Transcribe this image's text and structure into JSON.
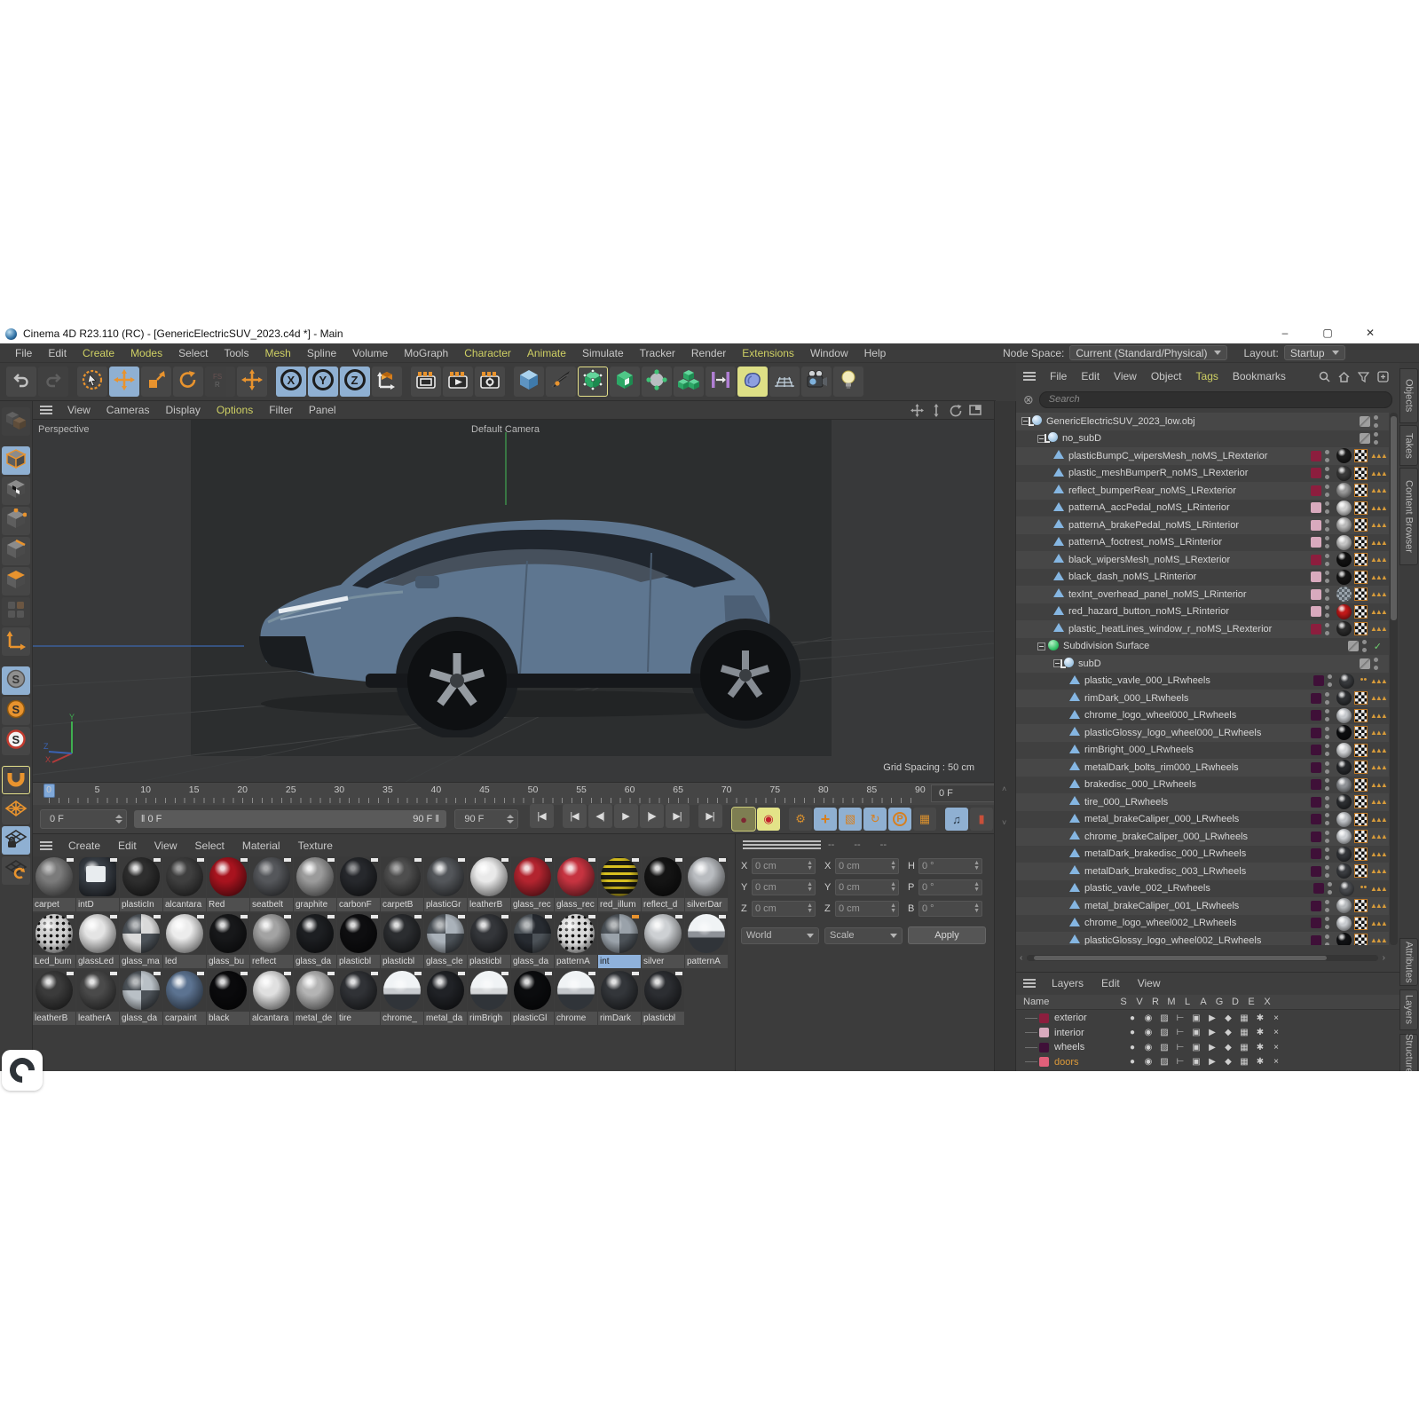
{
  "window": {
    "title": "Cinema 4D R23.110 (RC) - [GenericElectricSUV_2023.c4d *] - Main",
    "buttons": {
      "minimize": "–",
      "maximize": "▢",
      "close": "✕"
    }
  },
  "menu_bar": {
    "items": [
      {
        "label": "File"
      },
      {
        "label": "Edit"
      },
      {
        "label": "Create",
        "accent": true
      },
      {
        "label": "Modes",
        "accent": true
      },
      {
        "label": "Select"
      },
      {
        "label": "Tools"
      },
      {
        "label": "Mesh",
        "accent": true
      },
      {
        "label": "Spline"
      },
      {
        "label": "Volume"
      },
      {
        "label": "MoGraph"
      },
      {
        "label": "Character",
        "accent": true
      },
      {
        "label": "Animate",
        "accent": true
      },
      {
        "label": "Simulate"
      },
      {
        "label": "Tracker"
      },
      {
        "label": "Render"
      },
      {
        "label": "Extensions",
        "accent": true
      },
      {
        "label": "Window"
      },
      {
        "label": "Help"
      }
    ]
  },
  "node_space": {
    "label": "Node Space:",
    "value": "Current (Standard/Physical)"
  },
  "layout": {
    "label": "Layout:",
    "value": "Startup"
  },
  "toolbar": [
    {
      "name": "undo-button",
      "icon": "undo"
    },
    {
      "name": "redo-button",
      "icon": "redo",
      "disabled": true
    },
    {
      "sep": true
    },
    {
      "name": "live-selection-button",
      "icon": "cursor"
    },
    {
      "name": "move-button",
      "icon": "move",
      "bg": "blue"
    },
    {
      "name": "scale-button",
      "icon": "scale"
    },
    {
      "name": "rotate-button",
      "icon": "rotate"
    },
    {
      "name": "last-tool-button",
      "icon": "fsr",
      "disabled": true
    },
    {
      "name": "move-tool-button",
      "icon": "move"
    },
    {
      "sep": true
    },
    {
      "name": "x-axis-lock-button",
      "icon": "X",
      "bg": "blue"
    },
    {
      "name": "y-axis-lock-button",
      "icon": "Y",
      "bg": "blue"
    },
    {
      "name": "z-axis-lock-button",
      "icon": "Z",
      "bg": "blue"
    },
    {
      "name": "coordinate-system-button",
      "icon": "coordsys"
    },
    {
      "sep": true
    },
    {
      "name": "render-view-button",
      "icon": "clapper"
    },
    {
      "name": "render-picture-viewer-button",
      "icon": "clapperplay"
    },
    {
      "name": "render-settings-button",
      "icon": "clappergear"
    },
    {
      "sep": true
    },
    {
      "name": "add-cube-object-button",
      "icon": "cube"
    },
    {
      "name": "spline-pen-button",
      "icon": "pen"
    },
    {
      "name": "subdivision-surface-button",
      "icon": "sds",
      "outlined": true
    },
    {
      "name": "generators-button",
      "icon": "opencube"
    },
    {
      "name": "deformers-button",
      "icon": "deformer"
    },
    {
      "name": "mograph-cloner-button",
      "icon": "cubes3"
    },
    {
      "name": "fields-button",
      "icon": "field"
    },
    {
      "name": "volume-button",
      "icon": "volume",
      "bg": "yellow"
    },
    {
      "name": "floor-button",
      "icon": "floor"
    },
    {
      "name": "camera-button",
      "icon": "camera"
    },
    {
      "name": "light-button",
      "icon": "light"
    }
  ],
  "left_toolbar": [
    {
      "name": "make-editable-button",
      "icon": "cubegray",
      "disabled": true
    },
    {
      "gap": true
    },
    {
      "name": "model-mode-button",
      "icon": "cubemode",
      "bg": "blue"
    },
    {
      "name": "texture-mode-button",
      "icon": "cubechecker"
    },
    {
      "name": "point-mode-button",
      "icon": "cubepoints"
    },
    {
      "name": "edge-mode-button",
      "icon": "cubeedge"
    },
    {
      "name": "polygon-mode-button",
      "icon": "cubeface"
    },
    {
      "name": "tweak-mode-button",
      "icon": "tiles",
      "disabled": true
    },
    {
      "name": "enable-axis-button",
      "icon": "axis"
    },
    {
      "gap": true
    },
    {
      "name": "viewport-filter-button",
      "icon": "sgray",
      "bg": "blue"
    },
    {
      "name": "viewport-solo-single-button",
      "icon": "sorange"
    },
    {
      "name": "viewport-solo-hierarchy-button",
      "icon": "sred"
    },
    {
      "gap": true
    },
    {
      "name": "snap-button",
      "icon": "magnet",
      "outlined": true
    },
    {
      "name": "workplane-button",
      "icon": "grid"
    },
    {
      "name": "lock-workplane-button",
      "icon": "gridlock",
      "bg": "blue"
    },
    {
      "name": "planar-workplane-button",
      "icon": "gridrotate"
    }
  ],
  "viewport": {
    "menu": [
      {
        "label": "View"
      },
      {
        "label": "Cameras"
      },
      {
        "label": "Display"
      },
      {
        "label": "Options",
        "accent": true
      },
      {
        "label": "Filter"
      },
      {
        "label": "Panel"
      }
    ],
    "view_label": "Perspective",
    "camera_label": "Default Camera",
    "grid_spacing": "Grid Spacing : 50 cm",
    "nav_icons": [
      "pan-icon",
      "zoom-icon",
      "rotate-icon",
      "maximize-icon"
    ]
  },
  "timeline": {
    "ticks": [
      0,
      5,
      10,
      15,
      20,
      25,
      30,
      35,
      40,
      45,
      50,
      55,
      60,
      65,
      70,
      75,
      80,
      85,
      90
    ],
    "current_frame": "0 F",
    "range_start": "0 F",
    "range_end": "90 F",
    "end_frame": "90 F",
    "after_field": "0 F",
    "transport": [
      {
        "name": "goto-start-button",
        "glyph": "|◀",
        "gapAfter": true
      },
      {
        "name": "goto-previous-key-button",
        "glyph": "|◀"
      },
      {
        "name": "goto-previous-frame-button",
        "glyph": "◀|"
      },
      {
        "name": "play-button",
        "glyph": "▶"
      },
      {
        "name": "goto-next-frame-button",
        "glyph": "|▶"
      },
      {
        "name": "goto-next-key-button",
        "glyph": "▶|"
      },
      {
        "name": "goto-end-button",
        "glyph": "▶|",
        "gapBefore": true
      }
    ],
    "record_buttons": [
      {
        "name": "record-keyframe-button",
        "glyph": "●",
        "bg": "#7e7e52",
        "fg": "#7e2733",
        "outlined": true
      },
      {
        "name": "autokeying-button",
        "glyph": "◉",
        "bg": "#e3e388",
        "fg": "#c41f2d"
      },
      {
        "gap": true
      },
      {
        "name": "keyframe-selection-button",
        "glyph": "⚙",
        "bg": "#484848",
        "fg": "#d78f2e"
      },
      {
        "name": "key-position-button",
        "glyph": "+",
        "bg": "#8fb0d2",
        "fg": "#d77f1e"
      },
      {
        "name": "key-scale-button",
        "glyph": "▧",
        "bg": "#8fb0d2",
        "fg": "#d77f1e"
      },
      {
        "name": "key-rotation-button",
        "glyph": "↻",
        "bg": "#8fb0d2",
        "fg": "#d77f1e"
      },
      {
        "name": "key-parameter-button",
        "glyph": "P",
        "bg": "#8fb0d2",
        "fg": "#d77f1e",
        "ring": true
      },
      {
        "name": "key-pla-button",
        "glyph": "▦",
        "bg": "#484848",
        "fg": "#d78f2e"
      },
      {
        "gap": true
      },
      {
        "name": "sound-button",
        "glyph": "♫",
        "bg": "#8fb0d2",
        "fg": "#23313f"
      },
      {
        "name": "solo-animation-button",
        "glyph": "▮",
        "bg": "#484848",
        "fg": "#c8503a"
      }
    ]
  },
  "materials": {
    "menu": [
      {
        "label": "Create"
      },
      {
        "label": "Edit"
      },
      {
        "label": "View"
      },
      {
        "label": "Select"
      },
      {
        "label": "Material"
      },
      {
        "label": "Texture"
      }
    ],
    "rows": [
      [
        {
          "n": "carpet",
          "c": "#7b7b7b",
          "t": "noise"
        },
        {
          "n": "intD",
          "c": "#3a4048",
          "t": "screen"
        },
        {
          "n": "plasticIn",
          "c": "#2e2e2e"
        },
        {
          "n": "alcantara",
          "c": "#3f3f3f",
          "t": "noise"
        },
        {
          "n": "Red",
          "c": "#a8131e"
        },
        {
          "n": "seatbelt",
          "c": "#55575b",
          "t": "noise"
        },
        {
          "n": "graphite",
          "c": "#9b9b9b"
        },
        {
          "n": "carbonF",
          "c": "#26282c",
          "t": "noise"
        },
        {
          "n": "carpetB",
          "c": "#4e4e4e",
          "t": "noise"
        },
        {
          "n": "plasticGr",
          "c": "#53565a"
        },
        {
          "n": "leatherB",
          "c": "#e9e9e9"
        },
        {
          "n": "glass_rec",
          "c": "#b3242f"
        },
        {
          "n": "glass_rec",
          "c": "#c63340"
        },
        {
          "n": "red_illum",
          "c": "#1c1c12",
          "t": "stripes"
        },
        {
          "n": "reflect_d",
          "c": "#141414"
        },
        {
          "n": "silverDar",
          "c": "#b9bcc0"
        }
      ],
      [
        {
          "n": "Led_bum",
          "c": "#cfcfcf",
          "t": "dots"
        },
        {
          "n": "glassLed",
          "c": "#e4e4e4"
        },
        {
          "n": "glass_ma",
          "c": "#dadada",
          "t": "checker"
        },
        {
          "n": "led",
          "c": "#ececec"
        },
        {
          "n": "glass_bu",
          "c": "#17181a"
        },
        {
          "n": "reflect",
          "c": "#a3a3a3"
        },
        {
          "n": "glass_da",
          "c": "#1d1f22"
        },
        {
          "n": "plasticbl",
          "c": "#0e0e10"
        },
        {
          "n": "plasticbl",
          "c": "#2b2d30"
        },
        {
          "n": "glass_cle",
          "c": "#aab2ba",
          "t": "checker"
        },
        {
          "n": "plasticbl",
          "c": "#34363a"
        },
        {
          "n": "glass_da",
          "c": "#272b31",
          "t": "checker"
        },
        {
          "n": "patternA",
          "c": "#d9d9d9",
          "t": "dots"
        },
        {
          "n": "int",
          "c": "#9aa2aa",
          "t": "checker",
          "selected": true
        },
        {
          "n": "silver",
          "c": "#cdd0d3"
        },
        {
          "n": "patternA",
          "c": "#8e9298",
          "t": "chrome"
        }
      ],
      [
        {
          "n": "leatherB",
          "c": "#3b3b3b"
        },
        {
          "n": "leatherA",
          "c": "#4a4a4a"
        },
        {
          "n": "glass_da",
          "c": "#b9c0c6",
          "t": "checker"
        },
        {
          "n": "carpaint",
          "c": "#5c7391"
        },
        {
          "n": "black",
          "c": "#0a0a0c"
        },
        {
          "n": "alcantara",
          "c": "#e0e0e0"
        },
        {
          "n": "metal_de",
          "c": "#b4b4b4"
        },
        {
          "n": "tire",
          "c": "#303236"
        },
        {
          "n": "chrome_",
          "c": "#c9ccd0",
          "t": "chrome"
        },
        {
          "n": "metal_da",
          "c": "#202226"
        },
        {
          "n": "rimBrigh",
          "c": "#d6d8da",
          "t": "chrome"
        },
        {
          "n": "plasticGl",
          "c": "#0b0c0e"
        },
        {
          "n": "chrome",
          "c": "#c3c6ca",
          "t": "chrome"
        },
        {
          "n": "rimDark",
          "c": "#33363a"
        },
        {
          "n": "plasticbl",
          "c": "#2c2e32"
        }
      ]
    ]
  },
  "coordinates": {
    "headers": [
      "--",
      "--",
      "--"
    ],
    "rows": [
      [
        {
          "l": "X",
          "v": "0 cm"
        },
        {
          "l": "X",
          "v": "0 cm"
        },
        {
          "l": "H",
          "v": "0 °"
        }
      ],
      [
        {
          "l": "Y",
          "v": "0 cm"
        },
        {
          "l": "Y",
          "v": "0 cm"
        },
        {
          "l": "P",
          "v": "0 °"
        }
      ],
      [
        {
          "l": "Z",
          "v": "0 cm"
        },
        {
          "l": "Z",
          "v": "0 cm"
        },
        {
          "l": "B",
          "v": "0 °"
        }
      ]
    ],
    "dropdowns": [
      "World",
      "Scale"
    ],
    "apply_label": "Apply"
  },
  "object_manager": {
    "menu": [
      {
        "label": "File"
      },
      {
        "label": "Edit"
      },
      {
        "label": "View"
      },
      {
        "label": "Object"
      },
      {
        "label": "Tags",
        "accent": true
      },
      {
        "label": "Bookmarks"
      }
    ],
    "search_placeholder": "Search",
    "layer_colors": {
      "exterior": "#8c1e3e",
      "interior": "#d9aabe",
      "wheels": "#3f1038",
      "doors": "#e0607a"
    },
    "tree": [
      {
        "t": "GenericElectricSUV_2023_low.obj",
        "d": 0,
        "k": "null",
        "exp": true,
        "chip": "none"
      },
      {
        "t": "no_subD",
        "d": 1,
        "k": "null",
        "exp": true,
        "chip": "none"
      },
      {
        "t": "plasticBumpC_wipersMesh_noMS_LRexterior",
        "d": 2,
        "k": "poly",
        "chip": "exterior",
        "s": "#1b1b1b"
      },
      {
        "t": "plastic_meshBumperR_noMS_LRexterior",
        "d": 2,
        "k": "poly",
        "chip": "exterior",
        "s": "#3a3a3a"
      },
      {
        "t": "reflect_bumperRear_noMS_LRexterior",
        "d": 2,
        "k": "poly",
        "chip": "exterior",
        "s": "#9a9a9a"
      },
      {
        "t": "patternA_accPedal_noMS_LRinterior",
        "d": 2,
        "k": "poly",
        "chip": "interior",
        "s": "#cfcfcf"
      },
      {
        "t": "patternA_brakePedal_noMS_LRinterior",
        "d": 2,
        "k": "poly",
        "chip": "interior",
        "s": "#b9b9b9"
      },
      {
        "t": "patternA_footrest_noMS_LRinterior",
        "d": 2,
        "k": "poly",
        "chip": "interior",
        "s": "#c4c4c4"
      },
      {
        "t": "black_wipersMesh_noMS_LRexterior",
        "d": 2,
        "k": "poly",
        "chip": "exterior",
        "s": "#111111"
      },
      {
        "t": "black_dash_noMS_LRinterior",
        "d": 2,
        "k": "poly",
        "chip": "interior",
        "s": "#151515"
      },
      {
        "t": "texInt_overhead_panel_noMS_LRinterior",
        "d": 2,
        "k": "poly",
        "chip": "interior",
        "s": "#9aa4ac",
        "checkersph": true
      },
      {
        "t": "red_hazard_button_noMS_LRinterior",
        "d": 2,
        "k": "poly",
        "chip": "interior",
        "s": "#c01818"
      },
      {
        "t": "plastic_heatLines_window_r_noMS_LRexterior",
        "d": 2,
        "k": "poly",
        "chip": "exterior",
        "s": "#2a2a2a"
      },
      {
        "t": "Subdivision Surface",
        "d": 1,
        "k": "sds",
        "exp": true,
        "chip": "none",
        "check": true,
        "notags": true
      },
      {
        "t": "subD",
        "d": 2,
        "k": "null",
        "exp": true,
        "chip": "none",
        "notags": true
      },
      {
        "t": "plastic_vavle_000_LRwheels",
        "d": 3,
        "k": "poly",
        "chip": "wheels",
        "s": "#37393c",
        "dots": true
      },
      {
        "t": "rimDark_000_LRwheels",
        "d": 3,
        "k": "poly",
        "chip": "wheels",
        "s": "#2e3033"
      },
      {
        "t": "chrome_logo_wheel000_LRwheels",
        "d": 3,
        "k": "poly",
        "chip": "wheels",
        "s": "#c6c9cd"
      },
      {
        "t": "plasticGlossy_logo_wheel000_LRwheels",
        "d": 3,
        "k": "poly",
        "chip": "wheels",
        "s": "#0c0d0f"
      },
      {
        "t": "rimBright_000_LRwheels",
        "d": 3,
        "k": "poly",
        "chip": "wheels",
        "s": "#d2d4d6"
      },
      {
        "t": "metalDark_bolts_rim000_LRwheels",
        "d": 3,
        "k": "poly",
        "chip": "wheels",
        "s": "#26282b"
      },
      {
        "t": "brakedisc_000_LRwheels",
        "d": 3,
        "k": "poly",
        "chip": "wheels",
        "s": "#8f9296"
      },
      {
        "t": "tire_000_LRwheels",
        "d": 3,
        "k": "poly",
        "chip": "wheels",
        "s": "#2b2d30"
      },
      {
        "t": "metal_brakeCaliper_000_LRwheels",
        "d": 3,
        "k": "poly",
        "chip": "wheels",
        "s": "#bfc2c6"
      },
      {
        "t": "chrome_brakeCaliper_000_LRwheels",
        "d": 3,
        "k": "poly",
        "chip": "wheels",
        "s": "#cdd0d4"
      },
      {
        "t": "metalDark_brakedisc_000_LRwheels",
        "d": 3,
        "k": "poly",
        "chip": "wheels",
        "s": "#34363a"
      },
      {
        "t": "metalDark_brakedisc_003_LRwheels",
        "d": 3,
        "k": "poly",
        "chip": "wheels",
        "s": "#3a3c40"
      },
      {
        "t": "plastic_vavle_002_LRwheels",
        "d": 3,
        "k": "poly",
        "chip": "wheels",
        "s": "#4a4c50",
        "dots": true
      },
      {
        "t": "metal_brakeCaliper_001_LRwheels",
        "d": 3,
        "k": "poly",
        "chip": "wheels",
        "s": "#b7babd"
      },
      {
        "t": "chrome_logo_wheel002_LRwheels",
        "d": 3,
        "k": "poly",
        "chip": "wheels",
        "s": "#c9ccd0"
      },
      {
        "t": "plasticGlossy_logo_wheel002_LRwheels",
        "d": 3,
        "k": "poly",
        "chip": "wheels",
        "s": "#101113"
      }
    ]
  },
  "layers_panel": {
    "menu": [
      {
        "label": "Layers"
      },
      {
        "label": "Edit"
      },
      {
        "label": "View"
      }
    ],
    "name_column": "Name",
    "columns": [
      "S",
      "V",
      "R",
      "M",
      "L",
      "A",
      "G",
      "D",
      "E",
      "X"
    ],
    "flag_glyphs": [
      "●",
      "◉",
      "▨",
      "⊢",
      "▣",
      "▶",
      "◆",
      "▦",
      "✱",
      "×"
    ],
    "rows": [
      {
        "name": "exterior",
        "color": "#8c1e3e"
      },
      {
        "name": "interior",
        "color": "#d9aabe"
      },
      {
        "name": "wheels",
        "color": "#3f1038"
      },
      {
        "name": "doors",
        "color": "#e0607a",
        "selected": true
      }
    ]
  },
  "side_tabs": {
    "top": [
      "Objects",
      "Takes",
      "Content Browser"
    ],
    "bottom": [
      "Attributes",
      "Layers",
      "Structure"
    ]
  }
}
